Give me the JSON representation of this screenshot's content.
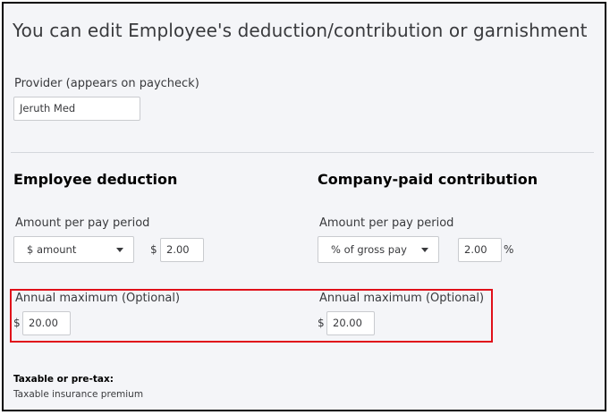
{
  "header": {
    "title": "You can edit Employee's deduction/contribution or garnishment"
  },
  "provider": {
    "label": "Provider (appears on paycheck)",
    "value": "Jeruth Med"
  },
  "employee": {
    "heading": "Employee deduction",
    "amount_label": "Amount per pay period",
    "type_select": "$ amount",
    "currency_symbol": "$",
    "amount_value": "2.00",
    "annual_label": "Annual maximum",
    "annual_optional": "(Optional)",
    "annual_symbol": "$",
    "annual_value": "20.00"
  },
  "company": {
    "heading": "Company-paid contribution",
    "amount_label": "Amount per pay period",
    "type_select": "% of gross pay",
    "amount_value": "2.00",
    "percent_symbol": "%",
    "annual_label": "Annual maximum",
    "annual_optional": "(Optional)",
    "annual_symbol": "$",
    "annual_value": "20.00"
  },
  "tax": {
    "label": "Taxable or pre-tax:",
    "value": "Taxable insurance premium"
  },
  "colors": {
    "highlight": "#e0101a",
    "background": "#f4f5f8",
    "border": "#000000"
  },
  "icons": {
    "dropdown": "chevron-down-icon"
  }
}
